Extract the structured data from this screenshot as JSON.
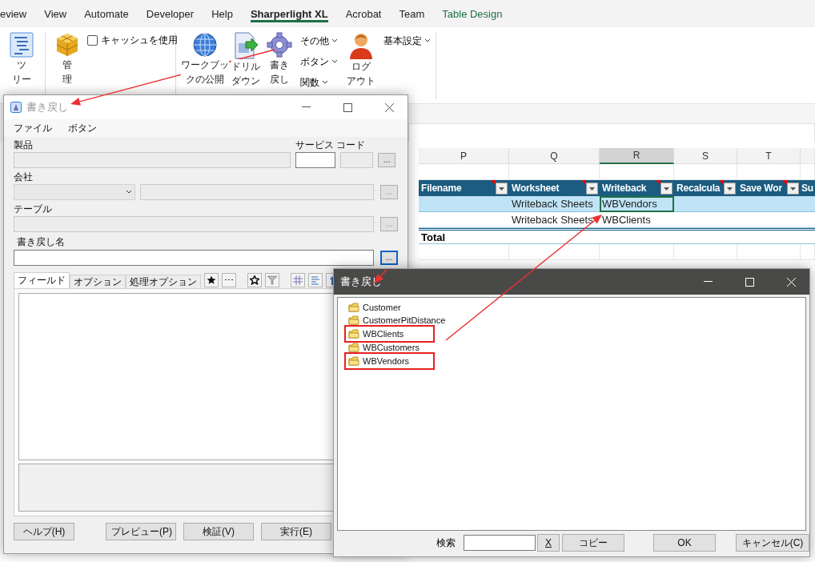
{
  "ribbon_tabs": [
    {
      "label": "eview",
      "selected": false,
      "kind": "normal"
    },
    {
      "label": "View",
      "selected": false,
      "kind": "normal"
    },
    {
      "label": "Automate",
      "selected": false,
      "kind": "normal"
    },
    {
      "label": "Developer",
      "selected": false,
      "kind": "normal"
    },
    {
      "label": "Help",
      "selected": false,
      "kind": "normal"
    },
    {
      "label": "Sharperlight XL",
      "selected": true,
      "kind": "normal"
    },
    {
      "label": "Acrobat",
      "selected": false,
      "kind": "normal"
    },
    {
      "label": "Team",
      "selected": false,
      "kind": "normal"
    },
    {
      "label": "Table Design",
      "selected": false,
      "kind": "contextual"
    }
  ],
  "ribbon_groups": [
    {
      "items": [
        {
          "kind": "large",
          "label_lines": [
            "ツ",
            "リー"
          ]
        }
      ]
    },
    {
      "items": [
        {
          "kind": "large",
          "label_lines": [
            "管",
            "理"
          ]
        },
        {
          "kind": "checkbox",
          "label": "キャッシュを使用",
          "checked": false
        }
      ]
    },
    {
      "items": [
        {
          "kind": "large",
          "label_lines": [
            "ワークブッ",
            "クの公開"
          ]
        },
        {
          "kind": "large",
          "label_lines": [
            "ドリル",
            "ダウン"
          ]
        },
        {
          "kind": "large",
          "label_lines": [
            "書き",
            "戻し"
          ]
        },
        {
          "kind": "menus",
          "entries": [
            "その他",
            "ボタン",
            "関数"
          ]
        },
        {
          "kind": "large",
          "label_lines": [
            "ログ",
            "アウト"
          ]
        },
        {
          "kind": "menus",
          "entries": [
            "基本設定"
          ]
        }
      ]
    }
  ],
  "sheet": {
    "columns": [
      {
        "letter": "P",
        "selected": false
      },
      {
        "letter": "Q",
        "selected": false
      },
      {
        "letter": "R",
        "selected": true
      },
      {
        "letter": "S",
        "selected": false
      },
      {
        "letter": "T",
        "selected": false
      }
    ],
    "table": {
      "headers": [
        "Filename",
        "Worksheet",
        "Writeback",
        "Recalcula",
        "Save Wor",
        "Su"
      ],
      "rows": [
        {
          "worksheet": "Writeback Sheets",
          "writeback": "WBVendors",
          "banded": true,
          "active": true
        },
        {
          "worksheet": "Writeback Sheets",
          "writeback": "WBClients",
          "banded": false,
          "active": false
        }
      ],
      "total_label": "Total"
    }
  },
  "writeback_dialog": {
    "title": "書き戻し",
    "active": false,
    "menu": [
      "ファイル",
      "ボタン"
    ],
    "product_label": "製品",
    "service_code_label": "サービス コード",
    "company_label": "会社",
    "table_label": "テーブル",
    "name_label": "書き戻し名",
    "browse_buttons": [
      "...",
      "...",
      "...",
      "..."
    ],
    "tabs": [
      {
        "label": "フィールド",
        "selected": true
      },
      {
        "label": "オプション",
        "selected": false
      },
      {
        "label": "処理オプション",
        "selected": false
      }
    ],
    "buttons": [
      "ヘルプ(H)",
      "プレビュー(P)",
      "検証(V)",
      "実行(E)"
    ]
  },
  "browse_dialog": {
    "title": "書き戻し",
    "active": true,
    "items": [
      {
        "label": "Customer",
        "highlighted": false
      },
      {
        "label": "CustomerPitDistance",
        "highlighted": false
      },
      {
        "label": "WBClients",
        "highlighted": true
      },
      {
        "label": "WBCustomers",
        "highlighted": false
      },
      {
        "label": "WBVendors",
        "highlighted": true
      }
    ],
    "search_label": "検索",
    "clear_button": "X",
    "copy_button": "コピー",
    "ok_button": "OK",
    "cancel_button": "キャンセル(C)"
  }
}
